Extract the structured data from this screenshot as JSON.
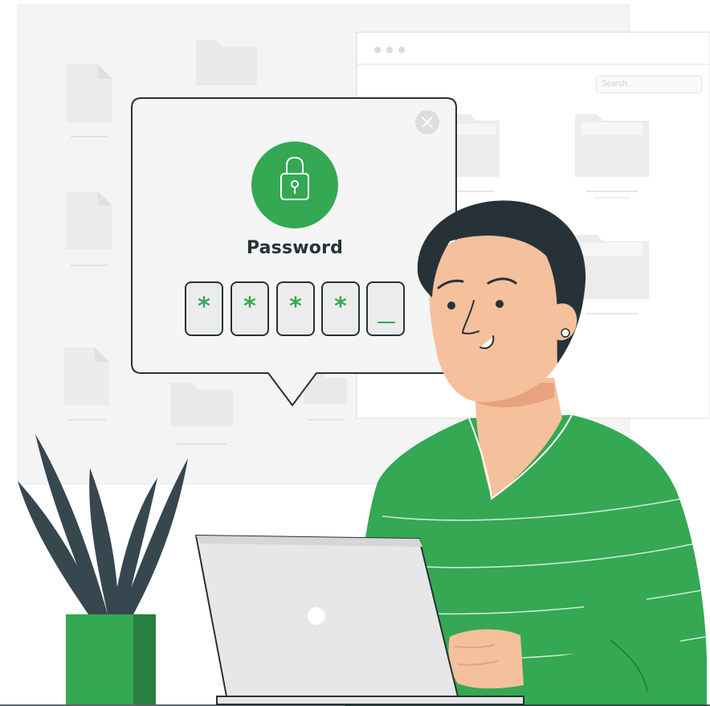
{
  "browser": {
    "search_placeholder": "Search..."
  },
  "dialog": {
    "title": "Password",
    "icon": "lock-icon",
    "close_icon": "close-icon",
    "pin_chars": [
      "*",
      "*",
      "*",
      "*",
      ""
    ]
  },
  "colors": {
    "accent": "#34a853",
    "accent_dark": "#27803e",
    "ink": "#263238",
    "skin": "#f5c09c",
    "panel": "#f4f4f4",
    "laptop": "#e7e7e7"
  }
}
